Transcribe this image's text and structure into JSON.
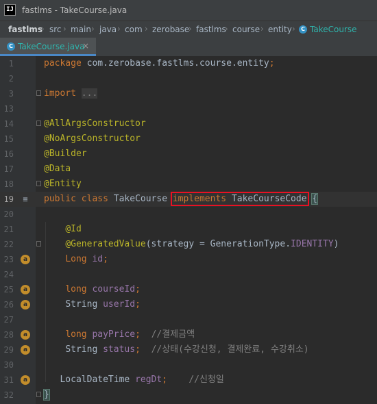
{
  "window": {
    "app_icon": "IJ",
    "title": "fastlms - TakeCourse.java"
  },
  "breadcrumb": [
    "fastlms",
    "src",
    "main",
    "java",
    "com",
    "zerobase",
    "fastlms",
    "course",
    "entity",
    "TakeCourse"
  ],
  "breadcrumb_last_icon": "C",
  "tab": {
    "icon": "C",
    "label": "TakeCourse.java",
    "close": "×"
  },
  "lines": [
    {
      "n": "1",
      "parts": [
        {
          "t": "package ",
          "c": "kw"
        },
        {
          "t": "com.zerobase.fastlms.course.entity",
          "c": "txt"
        },
        {
          "t": ";",
          "c": "kw"
        }
      ]
    },
    {
      "n": "2",
      "parts": []
    },
    {
      "n": "3",
      "parts": [
        {
          "t": "import ",
          "c": "kw"
        },
        {
          "t": "...",
          "c": "fold-hint"
        }
      ]
    },
    {
      "n": "13",
      "parts": []
    },
    {
      "n": "14",
      "parts": [
        {
          "t": "@AllArgsConstructor",
          "c": "ann"
        }
      ]
    },
    {
      "n": "15",
      "parts": [
        {
          "t": "@NoArgsConstructor",
          "c": "ann"
        }
      ]
    },
    {
      "n": "16",
      "parts": [
        {
          "t": "@Builder",
          "c": "ann"
        }
      ]
    },
    {
      "n": "17",
      "parts": [
        {
          "t": "@Data",
          "c": "ann"
        }
      ]
    },
    {
      "n": "18",
      "parts": [
        {
          "t": "@Entity",
          "c": "ann"
        }
      ]
    },
    {
      "n": "19",
      "parts": [
        {
          "t": "public class ",
          "c": "kw"
        },
        {
          "t": "TakeCourse ",
          "c": "txt"
        },
        {
          "t": "implements",
          "c": "kw",
          "hl": true
        },
        {
          "t": " TakeCourseCode",
          "c": "txt",
          "hl": true
        },
        {
          "t": " ",
          "c": "txt"
        },
        {
          "t": "{",
          "c": "brace"
        }
      ]
    },
    {
      "n": "20",
      "parts": []
    },
    {
      "n": "21",
      "parts": [
        {
          "t": "    ",
          "c": "txt"
        },
        {
          "t": "@Id",
          "c": "ann"
        }
      ]
    },
    {
      "n": "22",
      "parts": [
        {
          "t": "    ",
          "c": "txt"
        },
        {
          "t": "@GeneratedValue",
          "c": "ann"
        },
        {
          "t": "(strategy = GenerationType.",
          "c": "txt"
        },
        {
          "t": "IDENTITY",
          "c": "fld"
        },
        {
          "t": ")",
          "c": "txt"
        }
      ]
    },
    {
      "n": "23",
      "parts": [
        {
          "t": "    ",
          "c": "txt"
        },
        {
          "t": "Long ",
          "c": "kw"
        },
        {
          "t": "id",
          "c": "fld"
        },
        {
          "t": ";",
          "c": "kw"
        }
      ]
    },
    {
      "n": "24",
      "parts": []
    },
    {
      "n": "25",
      "parts": [
        {
          "t": "    ",
          "c": "txt"
        },
        {
          "t": "long ",
          "c": "kw"
        },
        {
          "t": "courseId",
          "c": "fld"
        },
        {
          "t": ";",
          "c": "kw"
        }
      ]
    },
    {
      "n": "26",
      "parts": [
        {
          "t": "    ",
          "c": "txt"
        },
        {
          "t": "String ",
          "c": "txt"
        },
        {
          "t": "userId",
          "c": "fld"
        },
        {
          "t": ";",
          "c": "kw"
        }
      ]
    },
    {
      "n": "27",
      "parts": []
    },
    {
      "n": "28",
      "parts": [
        {
          "t": "    ",
          "c": "txt"
        },
        {
          "t": "long ",
          "c": "kw"
        },
        {
          "t": "payPrice",
          "c": "fld"
        },
        {
          "t": ";  ",
          "c": "kw"
        },
        {
          "t": "//결제금액",
          "c": "cmt"
        }
      ]
    },
    {
      "n": "29",
      "parts": [
        {
          "t": "    ",
          "c": "txt"
        },
        {
          "t": "String ",
          "c": "txt"
        },
        {
          "t": "status",
          "c": "fld"
        },
        {
          "t": ";  ",
          "c": "kw"
        },
        {
          "t": "//상태(수강신청, 결제완료, 수강취소)",
          "c": "cmt"
        }
      ]
    },
    {
      "n": "30",
      "parts": []
    },
    {
      "n": "31",
      "parts": [
        {
          "t": "   ",
          "c": "txt"
        },
        {
          "t": "LocalDateTime ",
          "c": "txt"
        },
        {
          "t": "regDt",
          "c": "fld"
        },
        {
          "t": ";    ",
          "c": "kw"
        },
        {
          "t": "//신청일",
          "c": "cmt"
        }
      ]
    },
    {
      "n": "32",
      "parts": [
        {
          "t": "}",
          "c": "brace"
        }
      ]
    }
  ],
  "gutter_icons": {
    "19": {
      "type": "db",
      "glyph": "≡"
    },
    "23": {
      "type": "field",
      "glyph": "a"
    },
    "25": {
      "type": "field",
      "glyph": "a"
    },
    "26": {
      "type": "field",
      "glyph": "a"
    },
    "28": {
      "type": "field",
      "glyph": "a"
    },
    "29": {
      "type": "field",
      "glyph": "a"
    },
    "31": {
      "type": "field",
      "glyph": "a"
    }
  },
  "fold_markers": [
    "3",
    "14",
    "18",
    "22",
    "32"
  ],
  "colors": {
    "keyword": "#cc7832",
    "annotation": "#bbb529",
    "field": "#9876aa",
    "comment": "#808080",
    "text": "#a9b7c6",
    "highlight_box": "#e81123"
  }
}
